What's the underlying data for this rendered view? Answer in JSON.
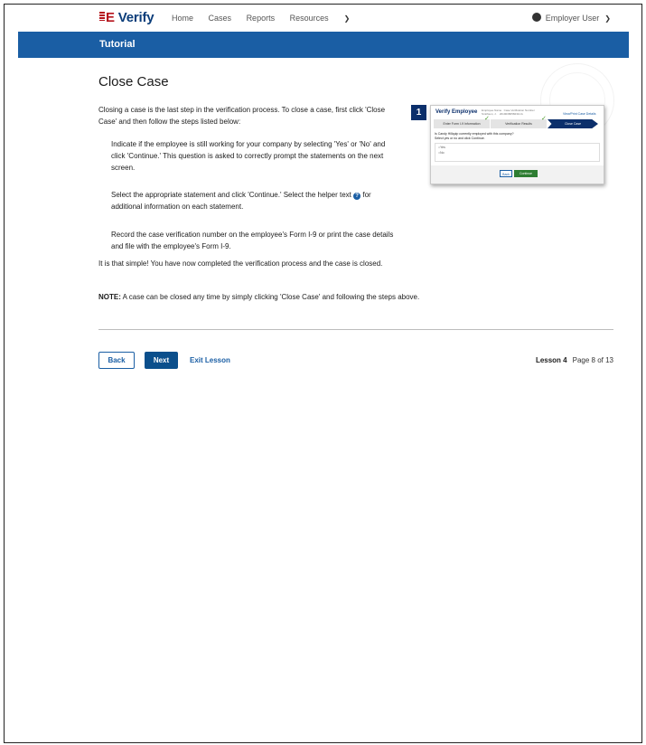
{
  "header": {
    "logo": "E Verify",
    "nav": [
      "Home",
      "Cases",
      "Reports",
      "Resources"
    ],
    "user": "Employer User"
  },
  "banner": {
    "title": "Tutorial"
  },
  "page": {
    "title": "Close Case",
    "intro": "Closing a case is the last step in the verification process. To close a case, first click 'Close Case' and then follow the steps listed below:",
    "steps": [
      "Indicate if the employee is still working for your company by selecting 'Yes' or 'No' and click 'Continue.' This question is asked to correctly prompt the statements on the next screen.",
      "Select the appropriate statement and click 'Continue.' Select the helper text",
      "for additional information on each statement.",
      "Record the case verification number on the employee's Form I-9 or print the case details and file with the employee's Form I-9."
    ],
    "closing": "It is that simple! You have now completed the verification process and the case is closed.",
    "note_label": "NOTE:",
    "note_text": "A case can be closed any time by simply clicking 'Close Case' and following the steps above."
  },
  "screenshot": {
    "number": "1",
    "title": "Verify Employee",
    "meta": "Employee Name   Case Verification Number\nSmithson, J.    2019038058231CA",
    "link": "View/Print Case Details",
    "tracker": [
      "Enter Form I-9 Information",
      "Verification Results",
      "Close Case"
    ],
    "question": "Is Candy Hillquip currently employed with this company?\nSelect yes or no and click Continue.",
    "options": [
      "Yes",
      "No"
    ],
    "back": "Back",
    "continue": "Continue"
  },
  "footer": {
    "back": "Back",
    "next": "Next",
    "exit": "Exit Lesson",
    "lesson": "Lesson 4",
    "page": "Page 8 of 13"
  },
  "colors": {
    "brand_blue": "#1a5ea4",
    "navy": "#0b2f6b",
    "everify_red": "#b5121b"
  }
}
